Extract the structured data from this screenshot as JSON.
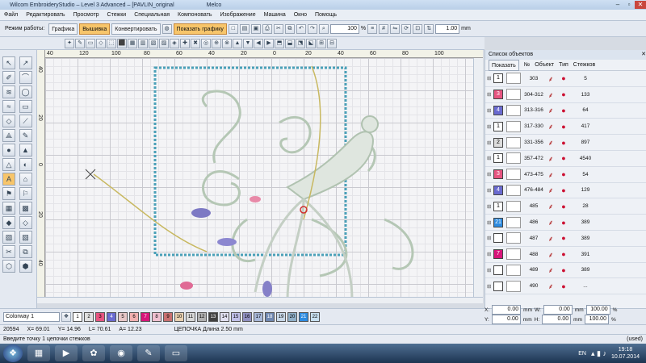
{
  "window": {
    "title": "Wilcom EmbroideryStudio – Level 3 Advanced – [PAVLIN_original",
    "user": "Melco"
  },
  "menu": [
    "Файл",
    "Редактировать",
    "Просмотр",
    "Стежки",
    "Специальная",
    "Компоновать",
    "Изображение",
    "Машина",
    "Окно",
    "Помощь"
  ],
  "toolbar": {
    "mode_label": "Режим работы:",
    "graphics": "Графика",
    "embroidery": "Вышивка",
    "convert": "Конвертировать",
    "show_graphics": "Показать графику",
    "zoom": "100",
    "zoom_unit": "%",
    "scale": "1.00",
    "scale_unit": "mm"
  },
  "ruler": {
    "top": [
      "40",
      "120",
      "100",
      "80",
      "60",
      "40",
      "20",
      "0",
      "20",
      "40",
      "60",
      "80",
      "100"
    ],
    "left": [
      "40",
      "20",
      "0",
      "20",
      "40"
    ]
  },
  "panel": {
    "title": "Список объектов",
    "show_btn": "Показать",
    "cols": [
      "№",
      "Объект",
      "Тип",
      "Стежков"
    ],
    "rows": [
      {
        "chk": "1",
        "color": "#ffffff",
        "num": "303",
        "st": "5"
      },
      {
        "chk": "3",
        "color": "#e75480",
        "num": "304-312",
        "st": "133"
      },
      {
        "chk": "4",
        "color": "#6a6ad0",
        "num": "313-316",
        "st": "64"
      },
      {
        "chk": "1",
        "color": "#ffffff",
        "num": "317-330",
        "st": "417"
      },
      {
        "chk": "2",
        "color": "#dcdcdc",
        "num": "331-356",
        "st": "897"
      },
      {
        "chk": "1",
        "color": "#ffffff",
        "num": "357-472",
        "st": "4540"
      },
      {
        "chk": "3",
        "color": "#e75480",
        "num": "473-475",
        "st": "54"
      },
      {
        "chk": "4",
        "color": "#6a6ad0",
        "num": "476-484",
        "st": "129"
      },
      {
        "chk": "1",
        "color": "#ffffff",
        "num": "485",
        "st": "28"
      },
      {
        "chk": "21",
        "color": "#2d8be0",
        "num": "486",
        "st": "389"
      },
      {
        "chk": "",
        "color": "#ffffff",
        "num": "487",
        "st": "389"
      },
      {
        "chk": "7",
        "color": "#d8157a",
        "num": "488",
        "st": "391"
      },
      {
        "chk": "",
        "color": "#ffffff",
        "num": "489",
        "st": "389"
      },
      {
        "chk": "",
        "color": "#ffffff",
        "num": "490",
        "st": "..."
      }
    ]
  },
  "colorway": {
    "label": "Colorway 1",
    "swatches": [
      {
        "n": "1",
        "c": "#ffffff"
      },
      {
        "n": "2",
        "c": "#e0e0e0"
      },
      {
        "n": "3",
        "c": "#e75480"
      },
      {
        "n": "4",
        "c": "#6a6ad0"
      },
      {
        "n": "5",
        "c": "#e8c8c8"
      },
      {
        "n": "6",
        "c": "#f2b0b0"
      },
      {
        "n": "7",
        "c": "#d8157a"
      },
      {
        "n": "8",
        "c": "#f0c0d0"
      },
      {
        "n": "9",
        "c": "#c87070"
      },
      {
        "n": "10",
        "c": "#e8d0b0"
      },
      {
        "n": "11",
        "c": "#d8d8d8"
      },
      {
        "n": "12",
        "c": "#b0b0b0"
      },
      {
        "n": "13",
        "c": "#404040"
      },
      {
        "n": "14",
        "c": "#e0e0f0"
      },
      {
        "n": "15",
        "c": "#c0c0e8"
      },
      {
        "n": "16",
        "c": "#9090c0"
      },
      {
        "n": "17",
        "c": "#a8b8d8"
      },
      {
        "n": "18",
        "c": "#7088b0"
      },
      {
        "n": "19",
        "c": "#c8d8e8"
      },
      {
        "n": "20",
        "c": "#90b0c8"
      },
      {
        "n": "21",
        "c": "#2d8be0"
      },
      {
        "n": "22",
        "c": "#c8e0f0"
      }
    ]
  },
  "coords": {
    "x1": "0.00",
    "y1": "0.00",
    "w": "0.00",
    "h": "0.00",
    "pct1": "100.00",
    "pct2": "100.00",
    "unit": "mm",
    "pct": "%"
  },
  "status": {
    "stitches": "20594",
    "x": "X= 69.01",
    "y": "Y= 14.96",
    "l": "L= 70.61",
    "a": "A= 12.23",
    "chain": "ЦЕПОЧКА Длина   2.50 mm",
    "hint": "Введите точку 1 цепочки стежков",
    "used": "(used)"
  },
  "tray": {
    "lang": "EN",
    "time": "19:18",
    "date": "10.07.2014"
  }
}
